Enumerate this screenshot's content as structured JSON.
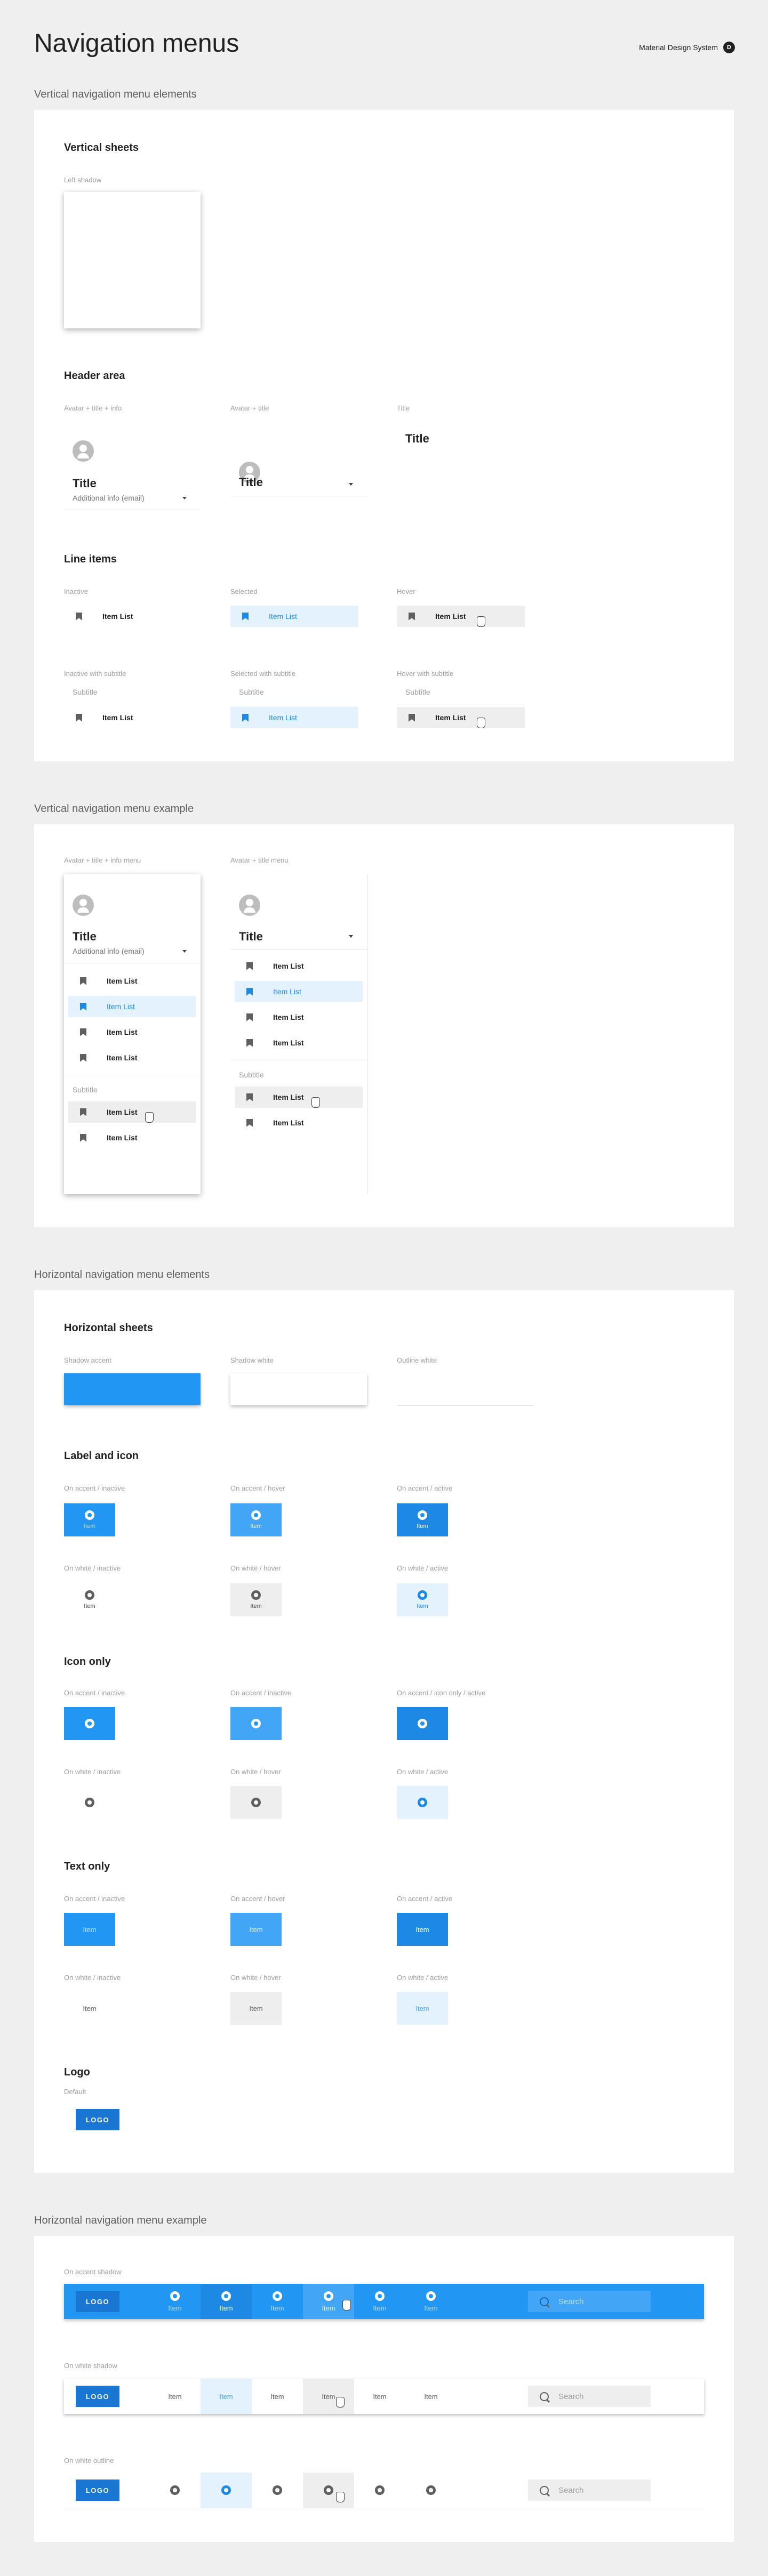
{
  "header": {
    "title": "Navigation menus",
    "brand": "Material Design System",
    "brand_mark": "D"
  },
  "colors": {
    "accent": "#2196f3",
    "accent_dark": "#1e88e5",
    "accent_hover": "#42a5f5",
    "selected_bg": "#e3f2fd",
    "hover_bg": "#eeeeee",
    "logo": "#1976d2"
  },
  "sections": {
    "vertical_elements": "Vertical navigation menu elements",
    "vertical_example": "Vertical navigation menu example",
    "horizontal_elements": "Horizontal navigation menu elements",
    "horizontal_example": "Horizontal navigation menu example"
  },
  "vertical_sheets": {
    "title": "Vertical sheets",
    "caption": "Left shadow"
  },
  "header_area": {
    "title": "Header area",
    "captions": [
      "Avatar + title + info",
      "Avatar + title",
      "Title"
    ],
    "header_title": "Title",
    "header_info": "Additional info (email)"
  },
  "line_items": {
    "title": "Line items",
    "captions": [
      "Inactive",
      "Selected",
      "Hover",
      "Inactive with subtitle",
      "Selected with subtitle",
      "Hover with subtitle"
    ],
    "item_label": "Item List",
    "subtitle": "Subtitle"
  },
  "vertical_example": {
    "captions": [
      "Avatar + title + info menu",
      "Avatar + title menu"
    ],
    "title": "Title",
    "info": "Additional info (email)",
    "item_label": "Item List",
    "subtitle": "Subtitle"
  },
  "horizontal_sheets": {
    "title": "Horizontal sheets",
    "captions": [
      "Shadow accent",
      "Shadow white",
      "Outline white"
    ]
  },
  "label_icon": {
    "title": "Label and icon",
    "captions": [
      "On accent / inactive",
      "On accent / hover",
      "On accent / active",
      "On white / inactive",
      "On white / hover",
      "On white / active"
    ],
    "item_label": "Item"
  },
  "icon_only": {
    "title": "Icon only",
    "captions": [
      "On accent / inactive",
      "On accent / inactive",
      "On accent / icon only / active",
      "On white / inactive",
      "On white / hover",
      "On white / active"
    ]
  },
  "text_only": {
    "title": "Text only",
    "captions": [
      "On accent / inactive",
      "On accent / hover",
      "On accent / active",
      "On white / inactive",
      "On white / hover",
      "On white / active"
    ],
    "item_label": "Item"
  },
  "logo": {
    "title": "Logo",
    "caption": "Default",
    "label": "LOGO"
  },
  "horizontal_example": {
    "captions": [
      "On accent shadow",
      "On white shadow",
      "On white outline"
    ],
    "logo": "LOGO",
    "item_label": "Item",
    "search_placeholder": "Search"
  }
}
